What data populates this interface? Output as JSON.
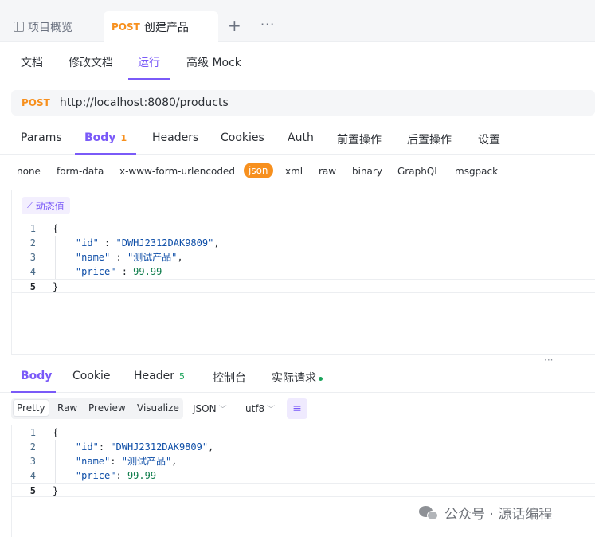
{
  "tabs": {
    "overview": "项目概览",
    "active_method": "POST",
    "active_label": "创建产品",
    "add": "+",
    "more": "···"
  },
  "doc_tabs": [
    "文档",
    "修改文档",
    "运行",
    "高级 Mock"
  ],
  "request": {
    "method": "POST",
    "url": "http://localhost:8080/products"
  },
  "req_tabs": {
    "params": "Params",
    "body": "Body",
    "body_count": "1",
    "headers": "Headers",
    "cookies": "Cookies",
    "auth": "Auth",
    "pre": "前置操作",
    "post": "后置操作",
    "settings": "设置"
  },
  "body_types": [
    "none",
    "form-data",
    "x-www-form-urlencoded",
    "json",
    "xml",
    "raw",
    "binary",
    "GraphQL",
    "msgpack"
  ],
  "dynamic_value": "动态值",
  "request_body": {
    "lines": [
      "1",
      "2",
      "3",
      "4",
      "5"
    ],
    "open": "{",
    "close": "}",
    "fields": [
      {
        "key": "\"id\"",
        "sep": " : ",
        "value": "\"DWHJ2312DAK9809\"",
        "end": ","
      },
      {
        "key": "\"name\"",
        "sep": " : ",
        "value": "\"测试产品\"",
        "end": ","
      },
      {
        "key": "\"price\"",
        "sep": " : ",
        "value": "99.99",
        "end": ""
      }
    ]
  },
  "resize_handle": "···",
  "res_tabs": {
    "body": "Body",
    "cookie": "Cookie",
    "header": "Header",
    "header_count": "5",
    "console": "控制台",
    "actual": "实际请求"
  },
  "view_modes": [
    "Pretty",
    "Raw",
    "Preview",
    "Visualize"
  ],
  "format_select": "JSON",
  "encoding_select": "utf8",
  "response_body": {
    "lines": [
      "1",
      "2",
      "3",
      "4",
      "5"
    ],
    "open": "{",
    "close": "}",
    "fields": [
      {
        "key": "\"id\"",
        "sep": ": ",
        "value": "\"DWHJ2312DAK9809\"",
        "end": ","
      },
      {
        "key": "\"name\"",
        "sep": ": ",
        "value": "\"测试产品\"",
        "end": ","
      },
      {
        "key": "\"price\"",
        "sep": ": ",
        "value": "99.99",
        "end": ""
      }
    ]
  },
  "watermark": "公众号 · 源话编程",
  "colors": {
    "accent": "#7a5af8",
    "method": "#f7901e",
    "success": "#1aa35a"
  }
}
